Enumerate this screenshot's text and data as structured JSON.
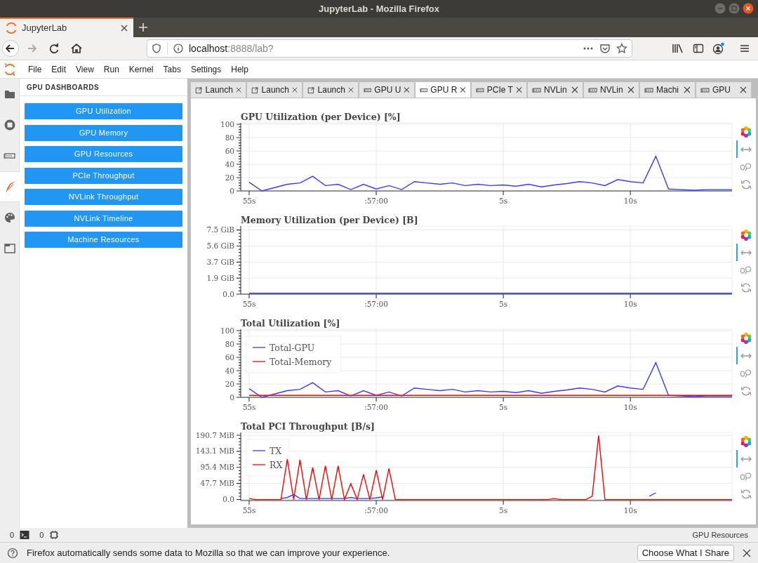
{
  "window": {
    "title": "JupyterLab - Mozilla Firefox"
  },
  "browser_tabs": [
    {
      "label": "JupyterLab",
      "selected": true
    }
  ],
  "nav_buttons": [
    {
      "kind": "back",
      "disabled": false
    },
    {
      "kind": "forward",
      "disabled": true
    },
    {
      "kind": "reload",
      "disabled": false
    },
    {
      "kind": "home",
      "disabled": false
    }
  ],
  "address_bar": {
    "host": "localhost",
    "rest": ":8888/lab?"
  },
  "menu": [
    "File",
    "Edit",
    "View",
    "Run",
    "Kernel",
    "Tabs",
    "Settings",
    "Help"
  ],
  "activity_bar": [
    {
      "kind": "folder",
      "selected": false
    },
    {
      "kind": "running",
      "selected": false
    },
    {
      "kind": "gpu",
      "selected": false
    },
    {
      "kind": "dashboards",
      "selected": true
    },
    {
      "kind": "palette",
      "selected": false
    },
    {
      "kind": "tabs",
      "selected": false
    }
  ],
  "sidebar": {
    "title": "GPU DASHBOARDS",
    "items": [
      "GPU Utilization",
      "GPU Memory",
      "GPU Resources",
      "PCIe Throughput",
      "NVLink Throughput",
      "NVLink Timeline",
      "Machine Resources"
    ]
  },
  "dock_tabs": [
    {
      "kind": "launcher",
      "label": "Launch",
      "selected": false
    },
    {
      "kind": "launcher",
      "label": "Launch",
      "selected": false
    },
    {
      "kind": "launcher",
      "label": "Launch",
      "selected": false
    },
    {
      "kind": "dashboard",
      "label": "GPU U",
      "selected": false
    },
    {
      "kind": "dashboard",
      "label": "GPU R",
      "selected": true
    },
    {
      "kind": "dashboard",
      "label": "PCIe T",
      "selected": false
    },
    {
      "kind": "dashboard",
      "label": "NVLin",
      "selected": false
    },
    {
      "kind": "dashboard",
      "label": "NVLin",
      "selected": false
    },
    {
      "kind": "dashboard",
      "label": "Machi",
      "selected": false
    },
    {
      "kind": "dashboard",
      "label": "GPU",
      "selected": false
    }
  ],
  "charts": [
    {
      "toolbar": [
        {
          "kind": "logo",
          "selected": false
        },
        {
          "kind": "pan",
          "selected": true
        },
        {
          "kind": "wheel_zoom",
          "selected": false
        },
        {
          "kind": "reset",
          "selected": false
        }
      ],
      "chart_data": {
        "type": "line",
        "title": "GPU Utilization (per Device) [%]",
        "grid": true,
        "categories": [
          "55s",
          null,
          null,
          null,
          null,
          null,
          null,
          null,
          null,
          null,
          ":57:00",
          null,
          null,
          null,
          null,
          null,
          null,
          null,
          null,
          null,
          "5s",
          null,
          null,
          null,
          null,
          null,
          null,
          null,
          null,
          null,
          "10s",
          null,
          null,
          null,
          null,
          null,
          null,
          null,
          null
        ],
        "series": [
          {
            "color": "#3a3aff",
            "values": [
              13,
              0,
              5,
              10,
              12,
              22,
              8,
              10,
              2,
              10,
              3,
              8,
              2,
              14,
              12,
              10,
              12,
              8,
              10,
              8,
              9,
              7,
              10,
              6,
              9,
              11,
              14,
              12,
              8,
              17,
              14,
              12,
              52,
              3,
              2,
              1,
              2,
              2,
              2
            ]
          }
        ],
        "ylim": [
          0,
          100
        ],
        "yticks": [
          0,
          20,
          40,
          60,
          80,
          100
        ]
      }
    },
    {
      "toolbar": [
        {
          "kind": "logo",
          "selected": false
        },
        {
          "kind": "pan",
          "selected": true
        },
        {
          "kind": "wheel_zoom",
          "selected": false
        },
        {
          "kind": "reset",
          "selected": false
        }
      ],
      "chart_data": {
        "type": "line",
        "title": "Memory Utilization (per Device) [B]",
        "grid": true,
        "categories": [
          "55s",
          null,
          null,
          null,
          null,
          null,
          null,
          null,
          null,
          null,
          ":57:00",
          null,
          null,
          null,
          null,
          null,
          null,
          null,
          null,
          null,
          "5s",
          null,
          null,
          null,
          null,
          null,
          null,
          null,
          null,
          null,
          "10s",
          null,
          null,
          null,
          null,
          null,
          null,
          null,
          null
        ],
        "series": [
          {
            "color": "#3a3aff",
            "values": [
              0.1,
              0.1,
              0.1,
              0.1,
              0.1,
              0.1,
              0.1,
              0.1,
              0.1,
              0.1,
              0.1,
              0.1,
              0.1,
              0.1,
              0.1,
              0.1,
              0.1,
              0.1,
              0.1,
              0.1,
              0.1,
              0.1,
              0.1,
              0.1,
              0.1,
              0.1,
              0.1,
              0.1,
              0.1,
              0.1,
              0.1,
              0.1,
              0.1,
              0.1,
              0.1,
              0.1,
              0.1,
              0.1,
              0.1
            ]
          }
        ],
        "ylim": [
          0,
          7.8
        ],
        "yticks": [
          {
            "value": 0,
            "label": "0.0"
          },
          {
            "value": 1.875,
            "label": "1.9 GiB"
          },
          {
            "value": 3.75,
            "label": "3.7 GiB"
          },
          {
            "value": 5.625,
            "label": "5.6 GiB"
          },
          {
            "value": 7.5,
            "label": "7.5 GiB"
          }
        ]
      }
    },
    {
      "toolbar": [
        {
          "kind": "logo",
          "selected": false
        },
        {
          "kind": "pan",
          "selected": true
        },
        {
          "kind": "wheel_zoom",
          "selected": false
        },
        {
          "kind": "reset",
          "selected": false
        }
      ],
      "chart_data": {
        "type": "line",
        "title": "Total Utilization [%]",
        "grid": true,
        "legend": true,
        "categories": [
          "55s",
          null,
          null,
          null,
          null,
          null,
          null,
          null,
          null,
          null,
          ":57:00",
          null,
          null,
          null,
          null,
          null,
          null,
          null,
          null,
          null,
          "5s",
          null,
          null,
          null,
          null,
          null,
          null,
          null,
          null,
          null,
          "10s",
          null,
          null,
          null,
          null,
          null,
          null,
          null,
          null
        ],
        "series": [
          {
            "name": "Total-GPU",
            "color": "#3a3aff",
            "values": [
              13,
              0,
              5,
              10,
              12,
              22,
              8,
              10,
              2,
              10,
              3,
              8,
              2,
              14,
              12,
              10,
              12,
              8,
              10,
              8,
              9,
              7,
              10,
              6,
              9,
              11,
              14,
              12,
              8,
              17,
              14,
              12,
              52,
              3,
              2,
              1,
              2,
              2,
              2
            ]
          },
          {
            "name": "Total-Memory",
            "color": "#ff0000",
            "values": [
              3,
              3,
              3,
              3,
              3,
              3,
              3,
              3,
              3,
              3,
              3,
              3,
              3,
              3,
              3,
              3,
              3,
              3,
              3,
              3,
              3,
              3,
              3,
              3,
              3,
              3,
              3,
              3,
              3,
              3,
              3,
              3,
              3,
              3,
              3,
              3,
              3,
              3,
              3
            ]
          }
        ],
        "ylim": [
          0,
          100
        ],
        "yticks": [
          0,
          20,
          40,
          60,
          80,
          100
        ]
      }
    },
    {
      "toolbar": [
        {
          "kind": "logo",
          "selected": false
        },
        {
          "kind": "pan",
          "selected": true
        },
        {
          "kind": "wheel_zoom",
          "selected": false
        },
        {
          "kind": "reset",
          "selected": false
        }
      ],
      "chart_data": {
        "type": "line",
        "title": "Total PCI Throughput [B/s]",
        "grid": true,
        "legend": true,
        "categories": [
          "55s",
          null,
          null,
          null,
          null,
          null,
          null,
          null,
          null,
          null,
          null,
          null,
          null,
          null,
          null,
          null,
          null,
          null,
          null,
          null,
          ":57:00",
          null,
          null,
          null,
          null,
          null,
          null,
          null,
          null,
          null,
          null,
          null,
          null,
          null,
          null,
          null,
          null,
          null,
          null,
          null,
          "5s",
          null,
          null,
          null,
          null,
          null,
          null,
          null,
          null,
          null,
          null,
          null,
          null,
          null,
          null,
          null,
          null,
          null,
          null,
          null,
          "10s",
          null,
          null,
          null,
          null,
          null,
          null,
          null,
          null,
          null,
          null,
          null,
          null,
          null,
          null,
          null,
          null
        ],
        "series": [
          {
            "name": "TX",
            "color": "#3a3aff",
            "values": [
              null,
              null,
              null,
              null,
              null,
              3,
              6,
              15,
              3,
              3,
              3,
              3,
              3,
              3,
              3,
              3,
              6,
              3,
              3,
              3,
              5,
              8,
              null,
              null,
              null,
              null,
              null,
              null,
              null,
              null,
              null,
              null,
              null,
              null,
              null,
              null,
              null,
              null,
              null,
              null,
              null,
              null,
              null,
              null,
              null,
              null,
              null,
              null,
              null,
              null,
              null,
              null,
              null,
              null,
              null,
              null,
              null,
              null,
              null,
              null,
              null,
              null,
              null,
              10,
              20,
              null,
              null,
              null,
              null,
              null,
              null,
              null,
              null,
              null,
              null,
              null,
              null
            ]
          },
          {
            "name": "RX",
            "color": "#ff0000",
            "values": [
              3,
              0,
              0,
              0,
              0,
              0,
              120,
              0,
              118,
              0,
              95,
              0,
              100,
              0,
              100,
              0,
              47,
              0,
              75,
              0,
              87,
              0,
              92,
              0,
              0,
              0,
              0,
              0,
              0,
              0,
              0,
              0,
              0,
              0,
              0,
              0,
              0,
              0,
              0,
              0,
              0,
              0,
              0,
              0,
              0,
              0,
              0,
              0,
              3,
              0,
              0,
              0,
              0,
              0,
              10,
              190,
              0,
              0,
              0,
              0,
              0,
              0,
              0,
              0,
              0,
              0,
              0,
              0,
              0,
              0,
              0,
              0,
              0,
              0,
              0,
              0,
              0
            ]
          }
        ],
        "ylim": [
          -3,
          195
        ],
        "yticks": [
          {
            "value": 0,
            "label": "0.0"
          },
          {
            "value": 47.7,
            "label": "47.7 MiB"
          },
          {
            "value": 95.4,
            "label": "95.4 MiB"
          },
          {
            "value": 143.1,
            "label": "143.1 MiB"
          },
          {
            "value": 190.7,
            "label": "190.7 MiB"
          }
        ]
      }
    }
  ],
  "status_bar": {
    "items": [
      {
        "kind": "terminal",
        "count": "0"
      },
      {
        "kind": "kernel",
        "count": "0"
      }
    ],
    "right": "GPU Resources"
  },
  "notification": {
    "text": "Firefox automatically sends some data to Mozilla so that we can improve your experience.",
    "button": "Choose What I Share"
  }
}
